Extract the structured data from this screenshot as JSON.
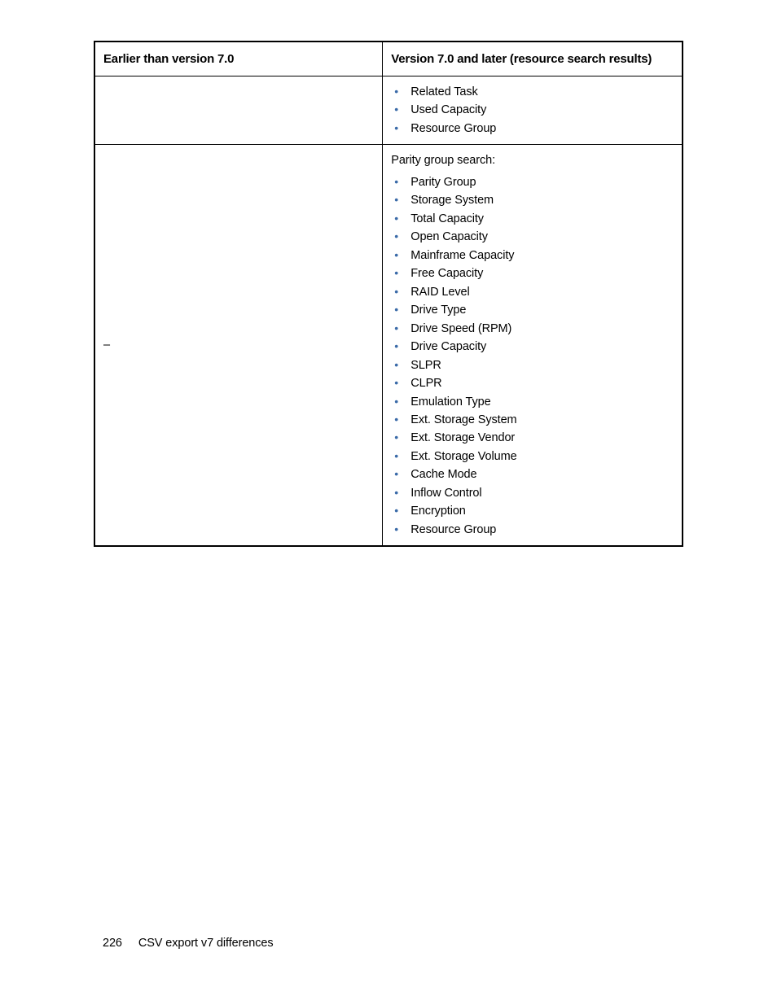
{
  "table": {
    "header_left": "Earlier than version 7.0",
    "header_right": "Version 7.0 and later (resource search results)",
    "rows": [
      {
        "left": "",
        "right_intro": "",
        "right_items": [
          "Related Task",
          "Used Capacity",
          "Resource Group"
        ]
      },
      {
        "left": "–",
        "right_intro": "Parity group search:",
        "right_items": [
          "Parity Group",
          "Storage System",
          "Total Capacity",
          "Open Capacity",
          "Mainframe Capacity",
          "Free Capacity",
          "RAID Level",
          "Drive Type",
          "Drive Speed (RPM)",
          "Drive Capacity",
          "SLPR",
          "CLPR",
          "Emulation Type",
          "Ext. Storage System",
          "Ext. Storage Vendor",
          "Ext. Storage Volume",
          "Cache Mode",
          "Inflow Control",
          "Encryption",
          "Resource Group"
        ]
      }
    ]
  },
  "footer": {
    "page_number": "226",
    "title": "CSV export v7 differences"
  }
}
